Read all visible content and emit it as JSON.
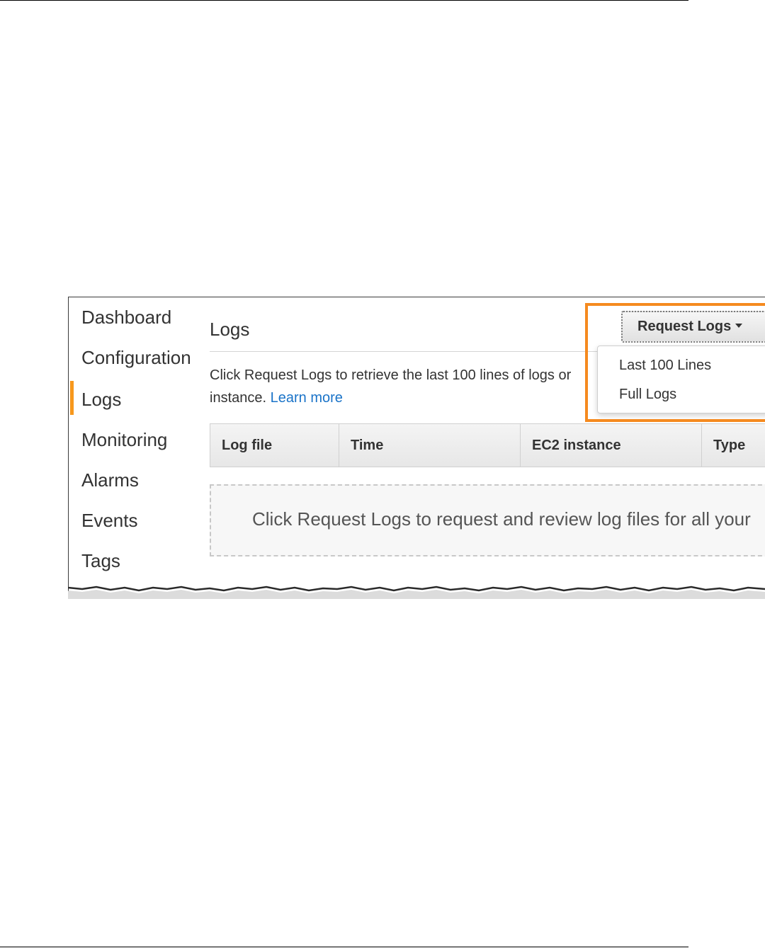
{
  "sidebar": {
    "items": [
      {
        "label": "Dashboard"
      },
      {
        "label": "Configuration"
      },
      {
        "label": "Logs",
        "active": true
      },
      {
        "label": "Monitoring"
      },
      {
        "label": "Alarms"
      },
      {
        "label": "Events"
      },
      {
        "label": "Tags"
      }
    ]
  },
  "main": {
    "title": "Logs",
    "description": "Click Request Logs to retrieve the last 100 lines of logs or",
    "description_line2": "instance.",
    "learn_more": "Learn more",
    "table": {
      "columns": [
        "Log file",
        "Time",
        "EC2 instance",
        "Type"
      ],
      "empty_message": "Click Request Logs to request and review log files for all your"
    }
  },
  "request_logs": {
    "button_label": "Request Logs",
    "menu": [
      "Last 100 Lines",
      "Full Logs"
    ]
  },
  "colors": {
    "highlight": "#f58a1f",
    "active_indicator": "#f7981d",
    "link": "#1a73c8"
  }
}
